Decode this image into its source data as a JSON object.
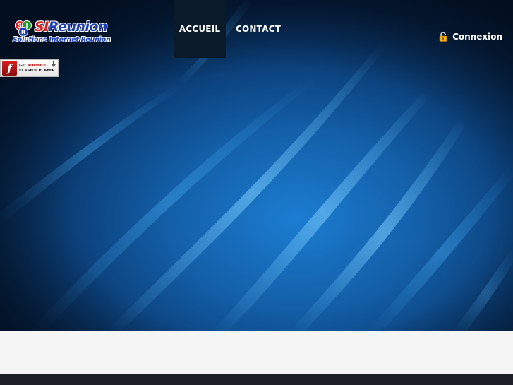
{
  "brand": {
    "name_prefix": "SI",
    "name_rest": "Reunion",
    "tagline": "Solutions Internet Reunion",
    "mark_letters": [
      "S",
      "I",
      "R"
    ],
    "colors": {
      "name": "#1e3fb4",
      "accent": "#e02020"
    }
  },
  "nav": {
    "items": [
      {
        "label": "ACCUEIL",
        "active": true
      },
      {
        "label": "CONTACT",
        "active": false
      }
    ]
  },
  "login": {
    "label": "Connexion",
    "icon": "padlock-icon"
  },
  "flash_badge": {
    "line1_get": "Get",
    "line1_adobe": "ADOBE®",
    "line2": "FLASH® PLAYER",
    "icon": "flash-player-icon"
  },
  "theme": {
    "hero_base": "#0b3f78",
    "hero_glow": "#1c7dd1",
    "nav_active_bg": "#0b1a2a",
    "band_bg": "#f5f5f5",
    "footer_bg": "#1c2026"
  }
}
